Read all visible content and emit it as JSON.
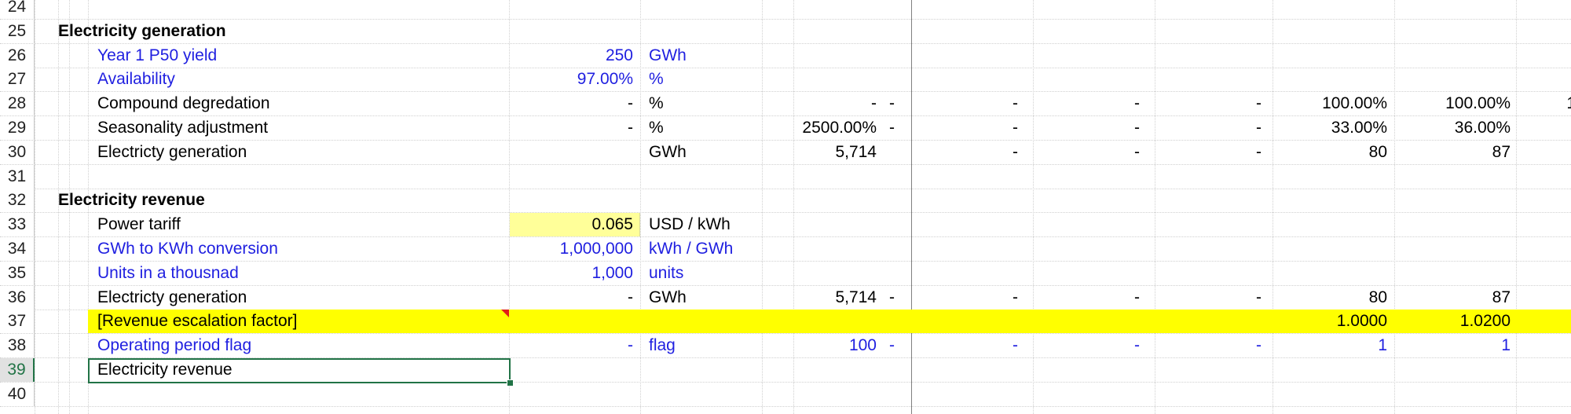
{
  "rows": [
    {
      "num": "24"
    },
    {
      "num": "25",
      "label": "Electricity generation",
      "label_style": "bold"
    },
    {
      "num": "26",
      "label": "Year 1 P50 yield",
      "label_color": "blue",
      "value": "250",
      "value_color": "blue",
      "unit": "GWh",
      "unit_color": "blue"
    },
    {
      "num": "27",
      "label": "Availability",
      "label_color": "blue",
      "value": "97.00%",
      "value_color": "blue",
      "unit": "%",
      "unit_color": "blue"
    },
    {
      "num": "28",
      "label": "Compound degredation",
      "value": "-",
      "unit": "%",
      "total": "-",
      "flag": "-",
      "periods": [
        "-",
        "-",
        "-",
        "100.00%",
        "100.00%",
        "1"
      ]
    },
    {
      "num": "29",
      "label": "Seasonality adjustment",
      "value": "-",
      "unit": "%",
      "total": "2500.00%",
      "flag": "-",
      "periods": [
        "-",
        "-",
        "-",
        "33.00%",
        "36.00%",
        ""
      ]
    },
    {
      "num": "30",
      "label": "Electricty generation",
      "unit": "GWh",
      "total": "5,714",
      "periods": [
        "-",
        "-",
        "-",
        "80",
        "87",
        ""
      ]
    },
    {
      "num": "31"
    },
    {
      "num": "32",
      "label": "Electricity revenue",
      "label_style": "bold"
    },
    {
      "num": "33",
      "label": "Power tariff",
      "value": "0.065",
      "value_fill": "input",
      "unit": "USD / kWh"
    },
    {
      "num": "34",
      "label": "GWh to KWh conversion",
      "label_color": "blue",
      "value": "1,000,000",
      "value_color": "blue",
      "unit": "kWh / GWh",
      "unit_color": "blue"
    },
    {
      "num": "35",
      "label": "Units in a thousnad",
      "label_color": "blue",
      "value": "1,000",
      "value_color": "blue",
      "unit": "units",
      "unit_color": "blue"
    },
    {
      "num": "36",
      "label": "Electricty generation",
      "value": "-",
      "unit": "GWh",
      "total": "5,714",
      "flag": "-",
      "periods": [
        "-",
        "-",
        "-",
        "80",
        "87",
        ""
      ]
    },
    {
      "num": "37",
      "label": "[Revenue escalation factor]",
      "row_fill": "yellow",
      "periods": [
        "",
        "",
        "",
        "1.0000",
        "1.0200",
        ""
      ]
    },
    {
      "num": "38",
      "label": "Operating period flag",
      "label_color": "blue",
      "value": "-",
      "value_color": "blue",
      "unit": "flag",
      "unit_color": "blue",
      "total": "100",
      "total_color": "blue",
      "flag": "-",
      "flag_color": "blue",
      "periods": [
        "-",
        "-",
        "-",
        "1",
        "1",
        ""
      ],
      "periods_color": "blue"
    },
    {
      "num": "39",
      "label": "Electricity revenue",
      "selected": true
    },
    {
      "num": "40"
    }
  ],
  "active_row": "39",
  "colors": {
    "blue": "#1f1fe0",
    "yellow": "#ffff00",
    "input": "#ffff99",
    "selection": "#217346"
  }
}
